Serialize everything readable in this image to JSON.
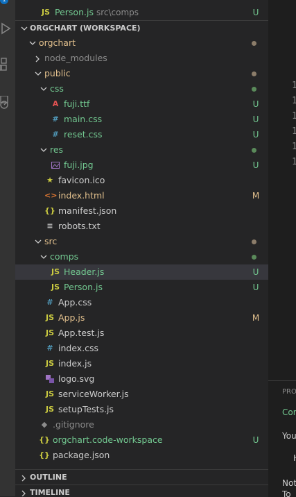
{
  "activity_bar": {
    "badge": "1",
    "icons": [
      "run-debug-icon",
      "extensions-icon",
      "remote-icon"
    ]
  },
  "explorer": {
    "workspace_title": "ORGCHART (WORKSPACE)",
    "top_partial": {
      "label": "Person.js",
      "path": "src\\comps",
      "status": "U"
    },
    "rows": [
      {
        "label": "orgchart",
        "icon": "",
        "status": "dot",
        "kind": "folder-open"
      },
      {
        "label": "node_modules",
        "icon": "",
        "status": "",
        "kind": "folder-closed"
      },
      {
        "label": "public",
        "icon": "",
        "status": "dot",
        "kind": "folder-open"
      },
      {
        "label": "css",
        "icon": "",
        "status": "dot-green",
        "kind": "folder-open"
      },
      {
        "label": "fuji.ttf",
        "icon": "A",
        "status": "U",
        "kind": "file"
      },
      {
        "label": "main.css",
        "icon": "#",
        "status": "U",
        "kind": "file"
      },
      {
        "label": "reset.css",
        "icon": "#",
        "status": "U",
        "kind": "file"
      },
      {
        "label": "res",
        "icon": "",
        "status": "dot-green",
        "kind": "folder-open"
      },
      {
        "label": "fuji.jpg",
        "icon": "img",
        "status": "U",
        "kind": "file"
      },
      {
        "label": "favicon.ico",
        "icon": "★",
        "status": "",
        "kind": "file"
      },
      {
        "label": "index.html",
        "icon": "<>",
        "status": "M",
        "kind": "file"
      },
      {
        "label": "manifest.json",
        "icon": "{}",
        "status": "",
        "kind": "file"
      },
      {
        "label": "robots.txt",
        "icon": "≡",
        "status": "",
        "kind": "file"
      },
      {
        "label": "src",
        "icon": "",
        "status": "dot",
        "kind": "folder-open"
      },
      {
        "label": "comps",
        "icon": "",
        "status": "dot-green",
        "kind": "folder-open"
      },
      {
        "label": "Header.js",
        "icon": "JS",
        "status": "U",
        "kind": "file"
      },
      {
        "label": "Person.js",
        "icon": "JS",
        "status": "U",
        "kind": "file"
      },
      {
        "label": "App.css",
        "icon": "#",
        "status": "",
        "kind": "file"
      },
      {
        "label": "App.js",
        "icon": "JS",
        "status": "M",
        "kind": "file"
      },
      {
        "label": "App.test.js",
        "icon": "JS",
        "status": "",
        "kind": "file"
      },
      {
        "label": "index.css",
        "icon": "#",
        "status": "",
        "kind": "file"
      },
      {
        "label": "index.js",
        "icon": "JS",
        "status": "",
        "kind": "file"
      },
      {
        "label": "logo.svg",
        "icon": "svg",
        "status": "",
        "kind": "file"
      },
      {
        "label": "serviceWorker.js",
        "icon": "JS",
        "status": "",
        "kind": "file"
      },
      {
        "label": "setupTests.js",
        "icon": "JS",
        "status": "",
        "kind": "file"
      },
      {
        "label": ".gitignore",
        "icon": "◆",
        "status": "",
        "kind": "file"
      },
      {
        "label": "orgchart.code-workspace",
        "icon": "{}",
        "status": "U",
        "kind": "file"
      },
      {
        "label": "package.json",
        "icon": "{}",
        "status": "",
        "kind": "file"
      }
    ],
    "outline_label": "OUTLINE",
    "timeline_label": "TIMELINE"
  },
  "editor": {
    "line_numbers": [
      "1",
      "1",
      "1",
      "1",
      "1",
      "1"
    ]
  },
  "panel": {
    "lines": [
      "PRO",
      "Com",
      "You",
      "H",
      "Not",
      "To"
    ]
  },
  "colors": {
    "untracked": "#73c991",
    "modified": "#e2c08d",
    "js_icon": "#cbcb41",
    "css_icon": "#519aba",
    "html_icon": "#e37933",
    "json_icon": "#cbcb41",
    "dot_gray": "#8c7d6a",
    "dot_green": "#5a8a5a",
    "selected_bg": "#37373d"
  }
}
